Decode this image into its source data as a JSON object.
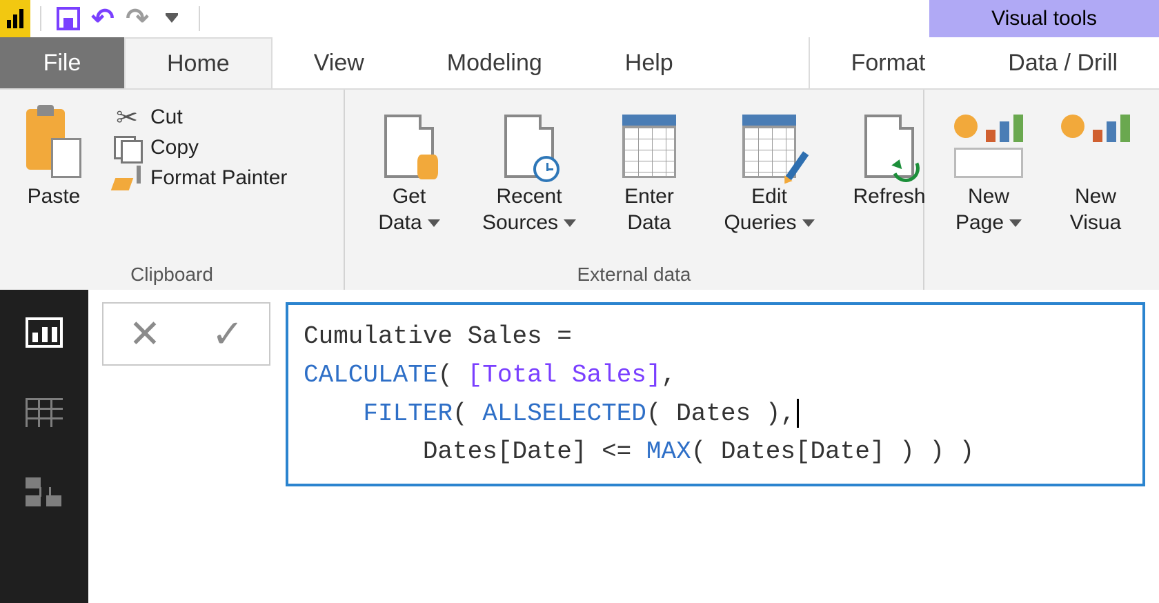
{
  "qat": {
    "contextual_label": "Visual tools"
  },
  "tabs": {
    "file": "File",
    "home": "Home",
    "view": "View",
    "modeling": "Modeling",
    "help": "Help",
    "format": "Format",
    "datadrill": "Data / Drill"
  },
  "ribbon": {
    "clipboard": {
      "group_label": "Clipboard",
      "paste": "Paste",
      "cut": "Cut",
      "copy": "Copy",
      "format_painter": "Format Painter"
    },
    "external": {
      "group_label": "External data",
      "get_data": {
        "l1": "Get",
        "l2": "Data"
      },
      "recent_sources": {
        "l1": "Recent",
        "l2": "Sources"
      },
      "enter_data": {
        "l1": "Enter",
        "l2": "Data"
      },
      "edit_queries": {
        "l1": "Edit",
        "l2": "Queries"
      },
      "refresh": "Refresh"
    },
    "insert": {
      "new_page": {
        "l1": "New",
        "l2": "Page"
      },
      "new_visual": {
        "l1": "New",
        "l2": "Visua"
      }
    }
  },
  "formula": {
    "line1_a": "Cumulative Sales = ",
    "line2_kw": "CALCULATE",
    "line2_a": "( ",
    "line2_col": "[Total Sales]",
    "line2_b": ",",
    "line3_pad": "    ",
    "line3_kw": "FILTER",
    "line3_a": "( ",
    "line3_kw2": "ALLSELECTED",
    "line3_b": "( Dates ),",
    "line4_pad": "        ",
    "line4_a": "Dates[Date] <= ",
    "line4_kw": "MAX",
    "line4_b": "( Dates[Date] ) ) )"
  },
  "xv": {
    "x": "✕",
    "v": "✓"
  }
}
